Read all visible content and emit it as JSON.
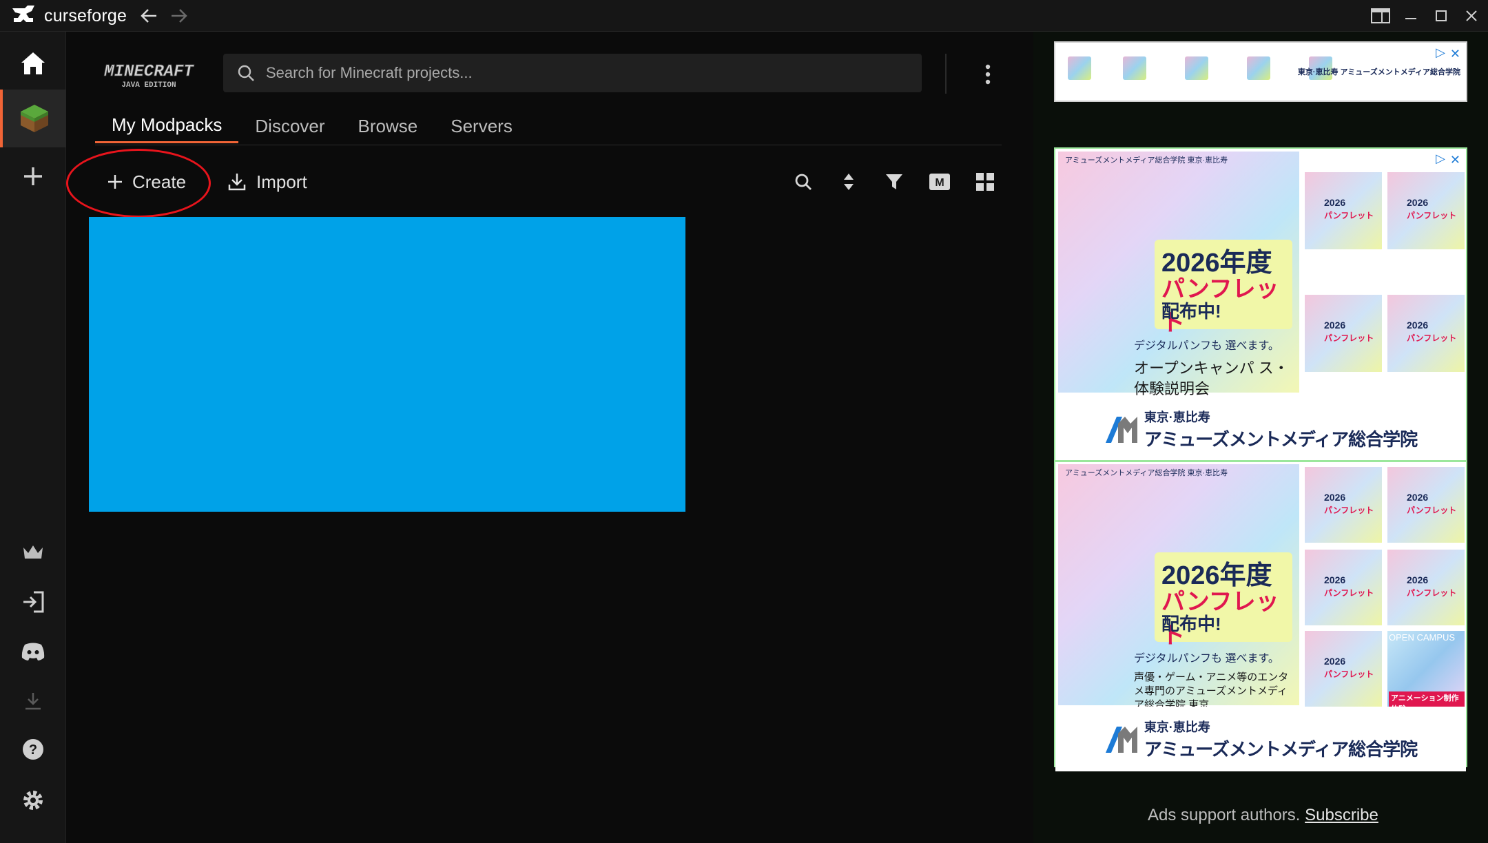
{
  "app": {
    "title": "curseforge"
  },
  "window": {
    "controls": [
      "layout-icon",
      "minimize-icon",
      "maximize-icon",
      "close-icon"
    ]
  },
  "sidebar": {
    "top": [
      "home-icon",
      "minecraft-icon",
      "add-icon"
    ],
    "bottom": [
      "crown-icon",
      "login-icon",
      "discord-icon",
      "download-icon",
      "help-icon",
      "settings-icon"
    ]
  },
  "game": {
    "logo_line1": "MINECRAFT",
    "logo_line2": "JAVA EDITION"
  },
  "search": {
    "placeholder": "Search for Minecraft projects..."
  },
  "tabs": [
    {
      "label": "My Modpacks",
      "active": true
    },
    {
      "label": "Discover"
    },
    {
      "label": "Browse"
    },
    {
      "label": "Servers"
    }
  ],
  "toolbar": {
    "create_label": "Create",
    "import_label": "Import",
    "view_mode_label": "M"
  },
  "ads": {
    "top_sponsor": "東京·恵比寿 アミューズメントメディア総合学院",
    "hero": {
      "school": "アミューズメントメディア総合学院 東京·恵比寿",
      "year": "2026年度",
      "pamphlet": "パンフレット",
      "distribution": "配布中!",
      "digital": "デジタルパンフも 選べます。",
      "caption1": "オープンキャンパ ス・体験説明会",
      "caption2": "声優・ゲーム・アニメ等のエンタ メ専門のアミューズメントメディ ア総合学院 東京"
    },
    "mini": {
      "year": "2026",
      "pamphlet": "パンフレット"
    },
    "campus": {
      "title": "OPEN CAMPUS",
      "tag": "アニメーション制作体験"
    },
    "footer_line1": "東京·恵比寿",
    "footer_line2": "アミューズメントメディア総合学院",
    "support_text": "Ads support authors.",
    "subscribe_label": "Subscribe"
  },
  "colors": {
    "accent": "#f16436",
    "highlight_block": "#00a2e8",
    "annotation": "#e8141c"
  }
}
